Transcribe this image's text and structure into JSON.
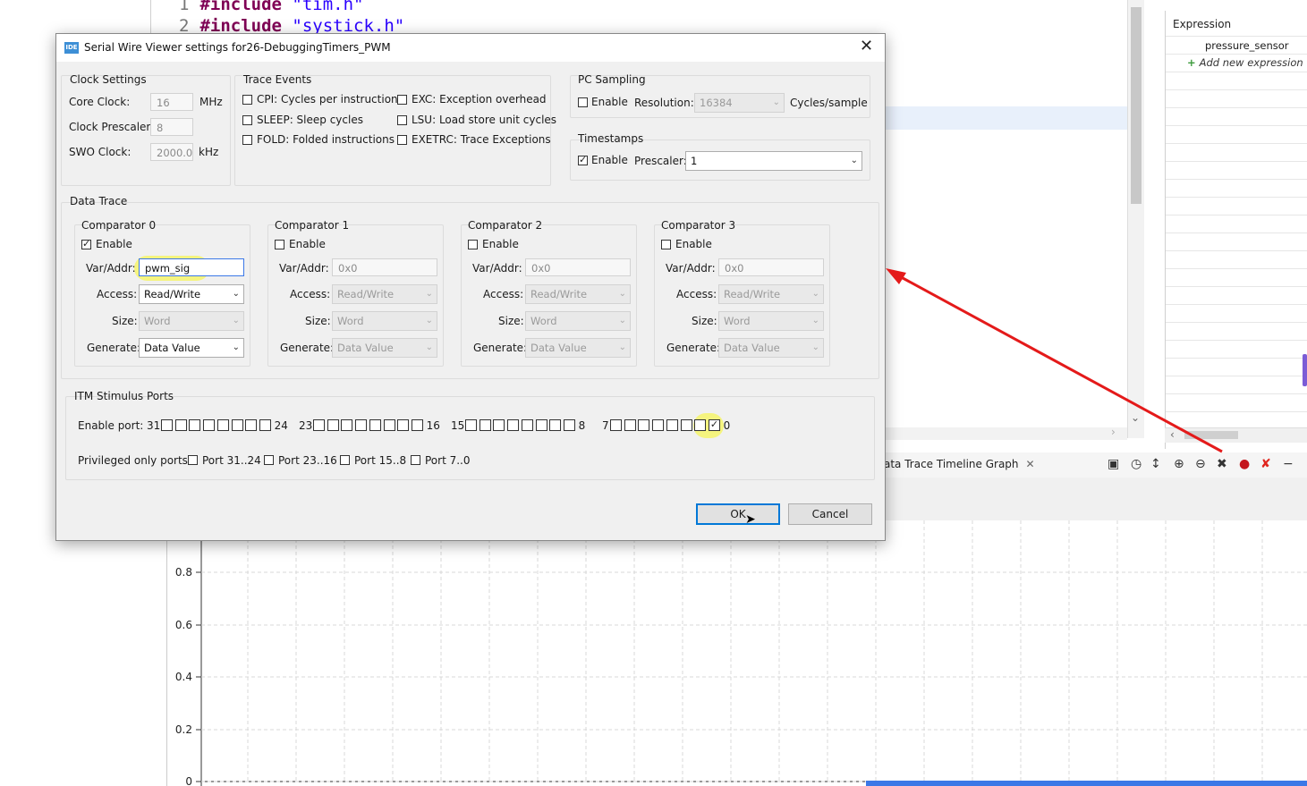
{
  "editor": {
    "lines": [
      {
        "num": "1",
        "keyword": "#include",
        "file": "\"tim.h\""
      },
      {
        "num": "2",
        "keyword": "#include",
        "file": "\"systick.h\""
      }
    ]
  },
  "expressions": {
    "header": "Expression",
    "items": [
      "pressure_sensor"
    ],
    "add_label": "Add new expression"
  },
  "graph_view": {
    "tab_label": "ata Trace Timeline Graph",
    "tab_close": "✕",
    "y_ticks": [
      "0.8",
      "0.6",
      "0.4",
      "0.2",
      "0"
    ]
  },
  "dialog": {
    "title": "Serial Wire Viewer settings for26-DebuggingTimers_PWM",
    "close_glyph": "✕",
    "clock": {
      "label": "Clock Settings",
      "core_label": "Core Clock:",
      "core_value": "16",
      "core_unit": "MHz",
      "prescaler_label": "Clock Prescaler:",
      "prescaler_value": "8",
      "swo_label": "SWO Clock:",
      "swo_value": "2000.0",
      "swo_unit": "kHz"
    },
    "trace_events": {
      "label": "Trace Events",
      "items": [
        {
          "label": "CPI: Cycles per instruction",
          "checked": false
        },
        {
          "label": "EXC: Exception overhead",
          "checked": false
        },
        {
          "label": "SLEEP: Sleep cycles",
          "checked": false
        },
        {
          "label": "LSU: Load store unit cycles",
          "checked": false
        },
        {
          "label": "FOLD: Folded instructions",
          "checked": false
        },
        {
          "label": "EXETRC: Trace Exceptions",
          "checked": false
        }
      ]
    },
    "pc_sampling": {
      "label": "PC Sampling",
      "enable_label": "Enable",
      "resolution_label": "Resolution:",
      "resolution_value": "16384",
      "unit": "Cycles/sample"
    },
    "timestamps": {
      "label": "Timestamps",
      "enable_label": "Enable",
      "prescaler_label": "Prescaler:",
      "prescaler_value": "1"
    },
    "data_trace": {
      "label": "Data Trace",
      "var_label": "Var/Addr:",
      "access_label": "Access:",
      "size_label": "Size:",
      "generate_label": "Generate:",
      "enable_label": "Enable",
      "comparators": [
        {
          "title": "Comparator 0",
          "enabled": true,
          "var": "pwm_sig",
          "access": "Read/Write",
          "size": "Word",
          "generate": "Data Value"
        },
        {
          "title": "Comparator 1",
          "enabled": false,
          "var": "0x0",
          "access": "Read/Write",
          "size": "Word",
          "generate": "Data Value"
        },
        {
          "title": "Comparator 2",
          "enabled": false,
          "var": "0x0",
          "access": "Read/Write",
          "size": "Word",
          "generate": "Data Value"
        },
        {
          "title": "Comparator 3",
          "enabled": false,
          "var": "0x0",
          "access": "Read/Write",
          "size": "Word",
          "generate": "Data Value"
        }
      ]
    },
    "itm": {
      "label": "ITM Stimulus Ports",
      "enable_port_label": "Enable port:",
      "groups": [
        {
          "hi": "31",
          "lo": "24"
        },
        {
          "hi": "23",
          "lo": "16"
        },
        {
          "hi": "15",
          "lo": "8"
        },
        {
          "hi": "7",
          "lo": "0"
        }
      ],
      "checked_port": 0,
      "privileged_label": "Privileged only ports:",
      "privileged": [
        "Port 31..24",
        "Port 23..16",
        "Port 15..8",
        "Port 7..0"
      ]
    },
    "ok_label": "OK",
    "cancel_label": "Cancel"
  }
}
